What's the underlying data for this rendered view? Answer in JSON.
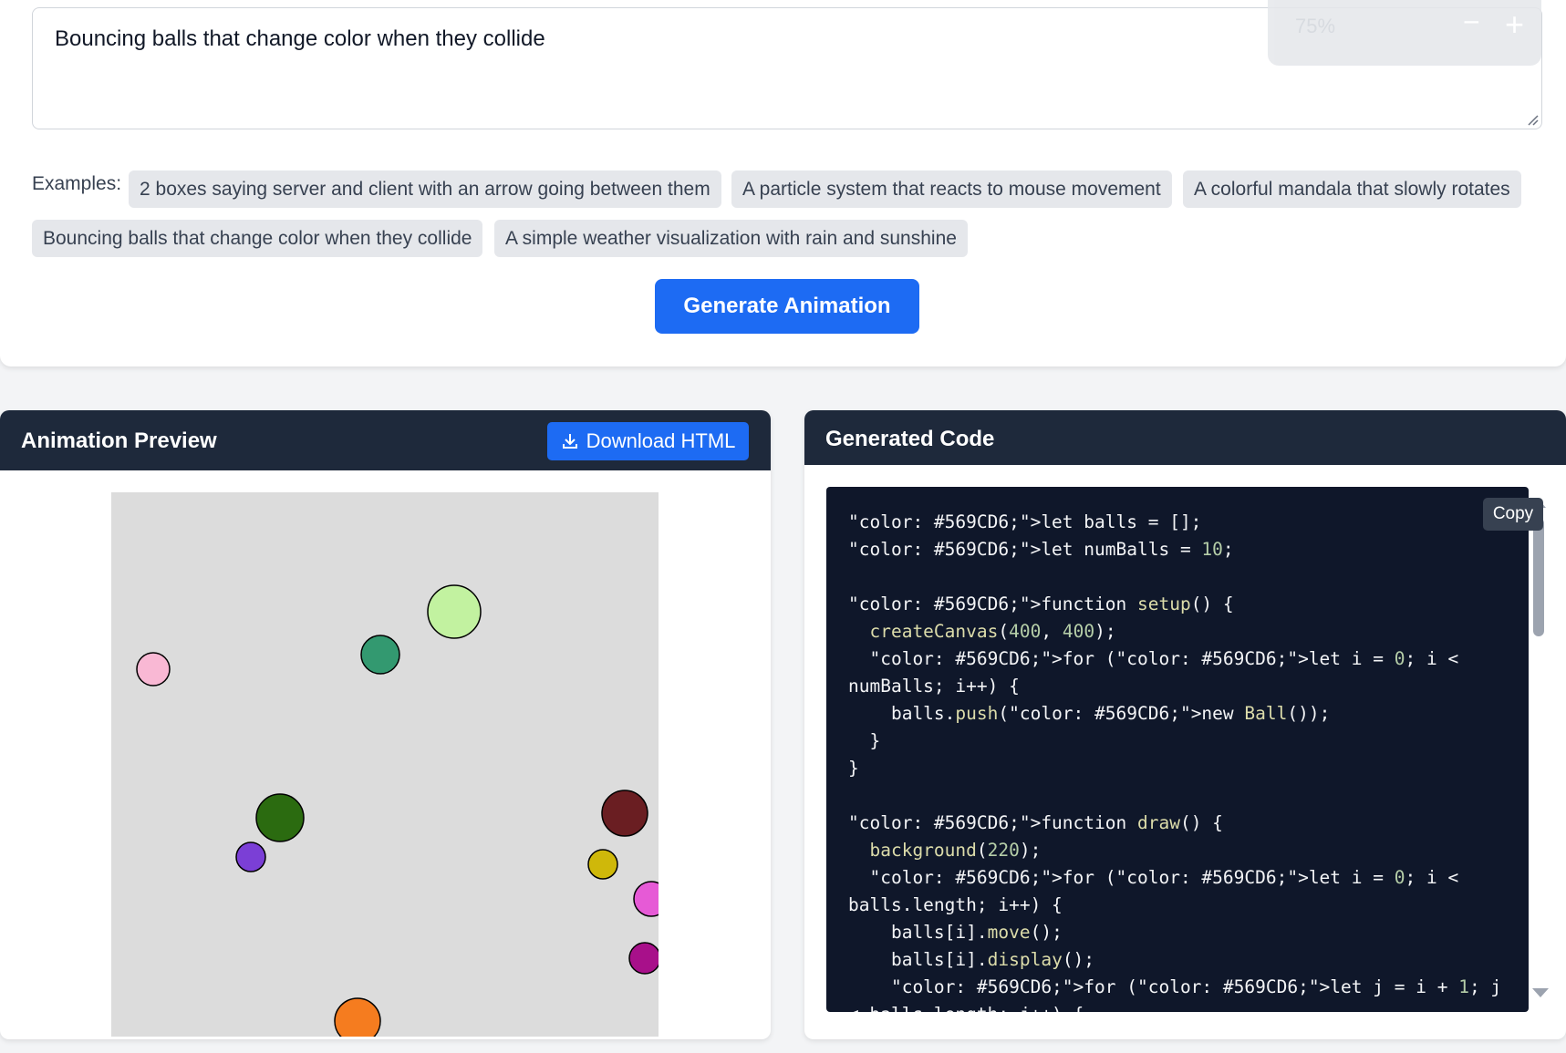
{
  "prompt": {
    "value": "Bouncing balls that change color when they collide"
  },
  "zoom": {
    "level": "75%",
    "minus": "−",
    "plus": "+"
  },
  "examples": {
    "label": "Examples:",
    "items": [
      "2 boxes saying server and client with an arrow going between them",
      "A particle system that reacts to mouse movement",
      "A colorful mandala that slowly rotates",
      "Bouncing balls that change color when they collide",
      "A simple weather visualization with rain and sunshine"
    ]
  },
  "generate_button": "Generate Animation",
  "preview": {
    "title": "Animation Preview",
    "download_label": "Download HTML",
    "download_icon": "download-icon",
    "canvas_bg": "#dcdcdc",
    "balls": [
      {
        "color": "#f9b8d4"
      },
      {
        "color": "#c2f2a0"
      },
      {
        "color": "#339970"
      },
      {
        "color": "#2b6b10"
      },
      {
        "color": "#7b3fd6"
      },
      {
        "color": "#6a1e22"
      },
      {
        "color": "#cfb80a"
      },
      {
        "color": "#e65ad6"
      },
      {
        "color": "#a8108a"
      },
      {
        "color": "#f57c1f"
      }
    ]
  },
  "code_panel": {
    "title": "Generated Code",
    "copy_label": "Copy",
    "lines": [
      "\"color: #569CD6;\">let balls = [];",
      "\"color: #569CD6;\">let numBalls = 10;",
      "",
      "\"color: #569CD6;\">function setup() {",
      "  createCanvas(400, 400);",
      "  \"color: #569CD6;\">for (\"color: #569CD6;\">let i = 0; i <",
      "numBalls; i++) {",
      "    balls.push(\"color: #569CD6;\">new Ball());",
      "  }",
      "}",
      "",
      "\"color: #569CD6;\">function draw() {",
      "  background(220);",
      "  \"color: #569CD6;\">for (\"color: #569CD6;\">let i = 0; i <",
      "balls.length; i++) {",
      "    balls[i].move();",
      "    balls[i].display();",
      "    \"color: #569CD6;\">for (\"color: #569CD6;\">let j = i + 1; j",
      "< balls.length; j++) {"
    ]
  },
  "colors": {
    "accent": "#1d6bf3",
    "panel_header": "#1e293b",
    "code_bg": "#0f172a",
    "chip_bg": "#e5e7eb",
    "fn_token": "#dcdcaa",
    "num_token": "#b5cea8"
  }
}
